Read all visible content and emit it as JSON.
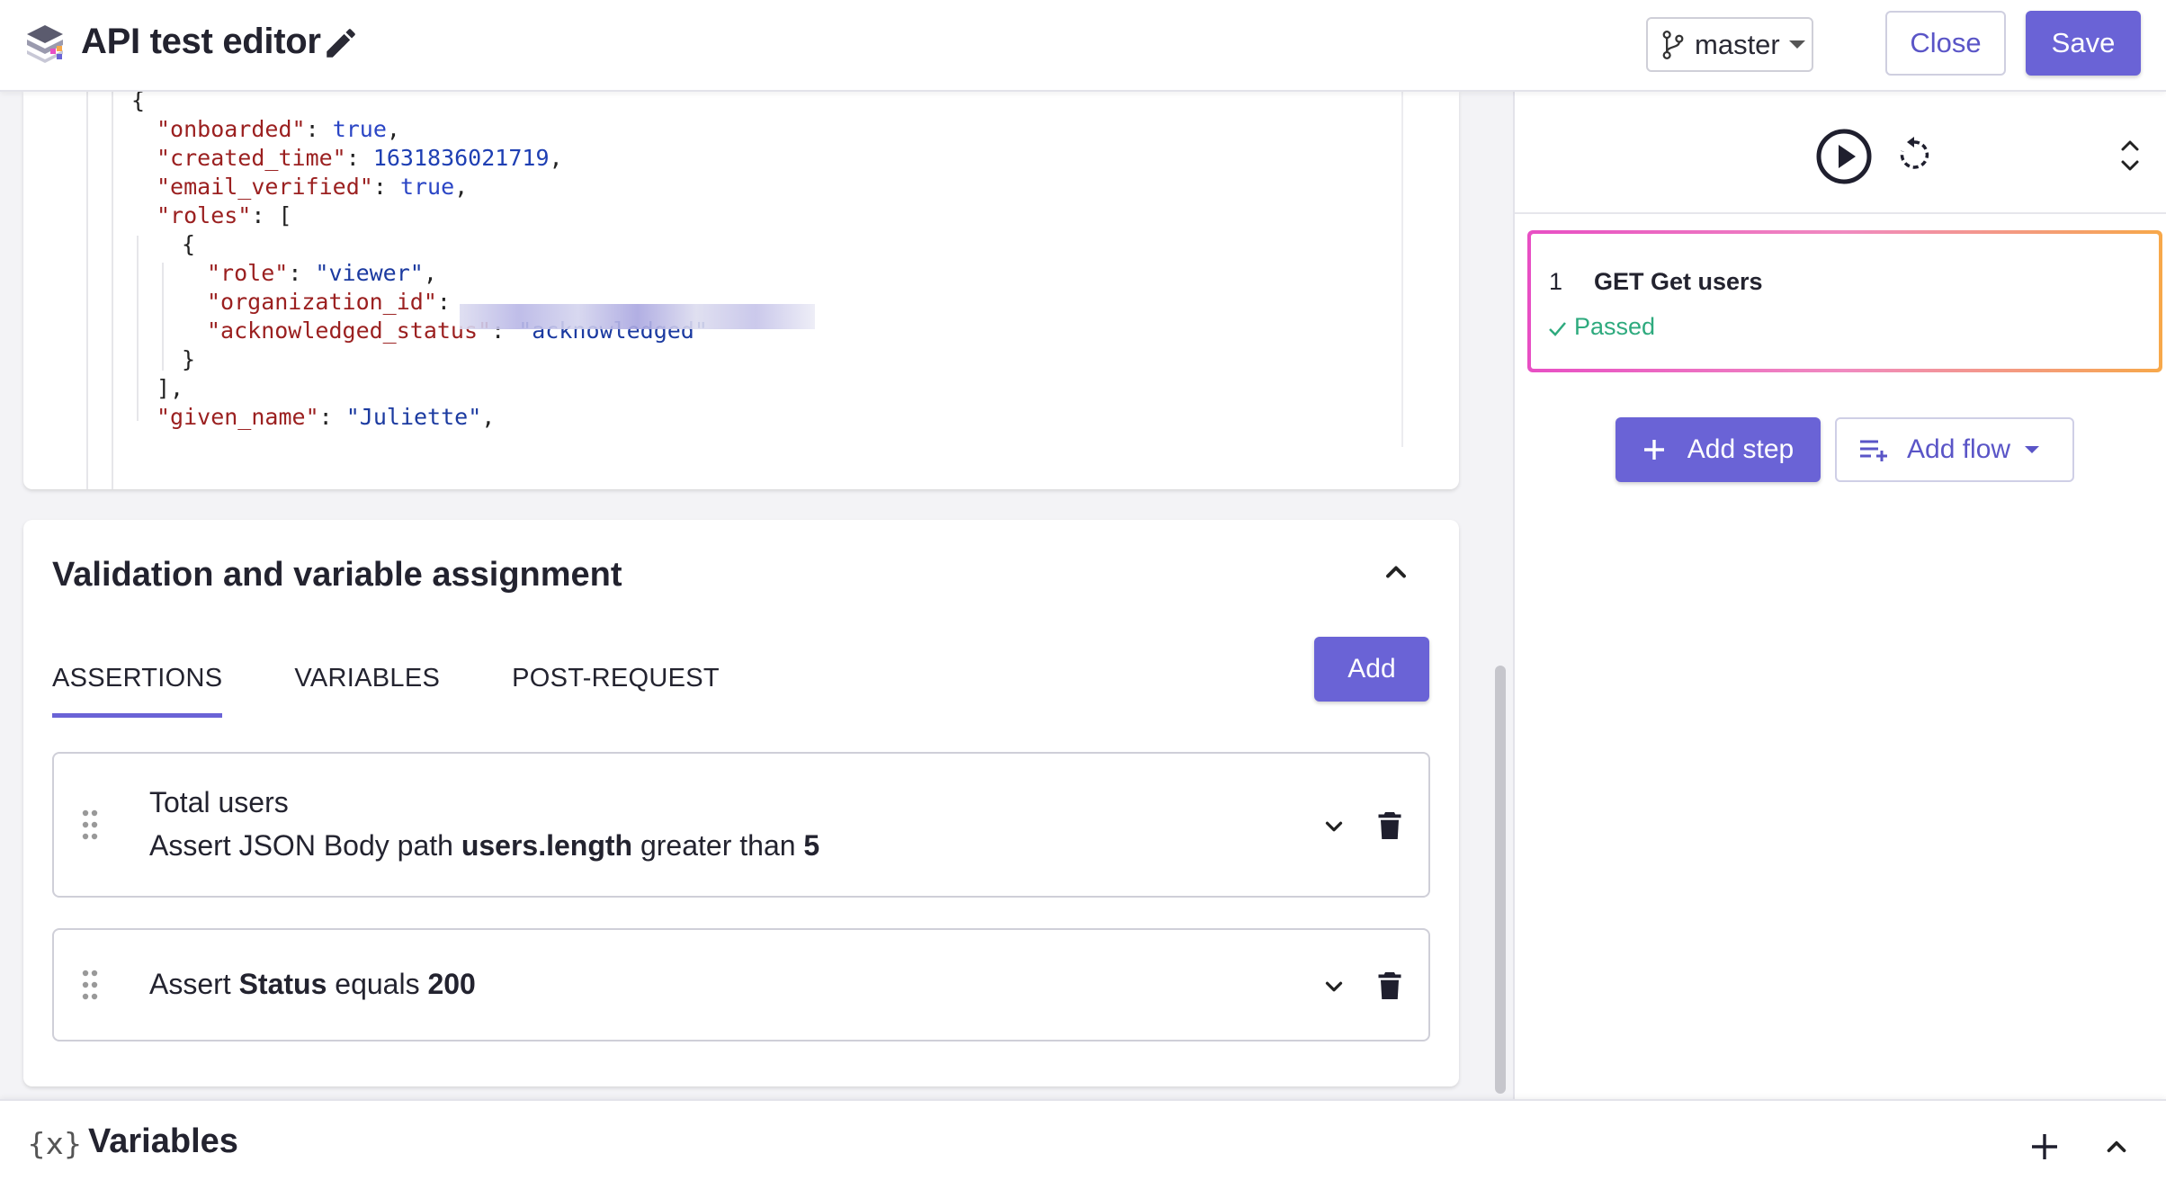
{
  "header": {
    "title": "API test editor",
    "branch": "master",
    "close_label": "Close",
    "save_label": "Save"
  },
  "response_body": {
    "lines": [
      [
        {
          "t": "p",
          "v": "{"
        }
      ],
      [
        {
          "t": "k",
          "v": "\"onboarded\""
        },
        {
          "t": "p",
          "v": ": "
        },
        {
          "t": "b",
          "v": "true"
        },
        {
          "t": "p",
          "v": ","
        }
      ],
      [
        {
          "t": "k",
          "v": "\"created_time\""
        },
        {
          "t": "p",
          "v": ": "
        },
        {
          "t": "n",
          "v": "1631836021719"
        },
        {
          "t": "p",
          "v": ","
        }
      ],
      [
        {
          "t": "k",
          "v": "\"email_verified\""
        },
        {
          "t": "p",
          "v": ": "
        },
        {
          "t": "b",
          "v": "true"
        },
        {
          "t": "p",
          "v": ","
        }
      ],
      [
        {
          "t": "k",
          "v": "\"roles\""
        },
        {
          "t": "p",
          "v": ": ["
        }
      ],
      [
        {
          "t": "p",
          "v": "{"
        }
      ],
      [
        {
          "t": "k",
          "v": "\"role\""
        },
        {
          "t": "p",
          "v": ": "
        },
        {
          "t": "s",
          "v": "\"viewer\""
        },
        {
          "t": "p",
          "v": ","
        }
      ],
      [
        {
          "t": "k",
          "v": "\"organization_id\""
        },
        {
          "t": "p",
          "v": ":"
        }
      ],
      [
        {
          "t": "k",
          "v": "\"acknowledged_status\""
        },
        {
          "t": "p",
          "v": ": "
        },
        {
          "t": "s",
          "v": "\"acknowledged\""
        }
      ],
      [
        {
          "t": "p",
          "v": "}"
        }
      ],
      [
        {
          "t": "p",
          "v": "],"
        }
      ],
      [
        {
          "t": "k",
          "v": "\"given_name\""
        },
        {
          "t": "p",
          "v": ": "
        },
        {
          "t": "s",
          "v": "\"Juliette\""
        },
        {
          "t": "p",
          "v": ","
        }
      ]
    ]
  },
  "validation": {
    "title": "Validation and variable assignment",
    "tabs": [
      "ASSERTIONS",
      "VARIABLES",
      "POST-REQUEST"
    ],
    "add_label": "Add",
    "assertions": [
      {
        "name": "Total users",
        "prefix": "Assert JSON Body path",
        "target": "users.length",
        "op": "greater than",
        "value": "5"
      },
      {
        "prefix": "Assert",
        "target": "Status",
        "op": "equals",
        "value": "200"
      }
    ]
  },
  "run_panel": {
    "steps": [
      {
        "number": "1",
        "title": "GET Get users",
        "status": "Passed"
      }
    ],
    "add_step_label": "Add step",
    "add_flow_label": "Add flow"
  },
  "footer": {
    "icon": "{x}",
    "title": "Variables"
  },
  "colors": {
    "accent": "#6a63d6",
    "passed": "#2eaa7e"
  }
}
